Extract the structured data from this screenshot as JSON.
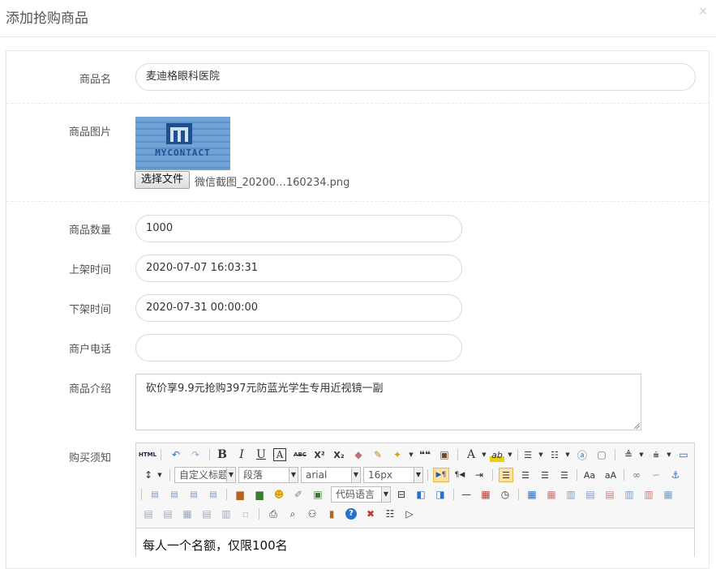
{
  "modal": {
    "title": "添加抢购商品",
    "close_symbol": "×"
  },
  "form": {
    "name": {
      "label": "商品名",
      "value": "麦迪格眼科医院"
    },
    "image": {
      "label": "商品图片",
      "choose_file_label": "选择文件",
      "file_name": "微信截图_20200…160234.png",
      "thumb_text": "MYCONTACT"
    },
    "quantity": {
      "label": "商品数量",
      "value": "1000"
    },
    "start_time": {
      "label": "上架时间",
      "value": "2020-07-07 16:03:31"
    },
    "end_time": {
      "label": "下架时间",
      "value": "2020-07-31 00:00:00"
    },
    "merchant_phone": {
      "label": "商户电话",
      "value": ""
    },
    "intro": {
      "label": "商品介绍",
      "value": "砍价享9.9元抢购397元防蓝光学生专用近视镜一副"
    },
    "notice": {
      "label": "购买须知",
      "content": "每人一个名额，仅限100名"
    }
  },
  "editor": {
    "selects": {
      "custom_heading": "自定义标题",
      "paragraph": "段落",
      "font_family": "arial",
      "font_size": "16px",
      "code_language": "代码语言"
    },
    "icon_text": {
      "html": "HTML",
      "bold": "B",
      "italic": "I",
      "underline": "U",
      "font_border": "A",
      "strikethrough": "ABC",
      "superscript": "X²",
      "subscript": "X₂",
      "quote": "❝❝",
      "font_color": "A",
      "highlight": "ab",
      "ltr": "▶¶",
      "rtl": "¶◀",
      "help": "?"
    }
  },
  "colors": {
    "thumb_bg": "#6fa3d6",
    "selected_tool_bg": "#fde1a6",
    "border": "#d9d9d9"
  }
}
